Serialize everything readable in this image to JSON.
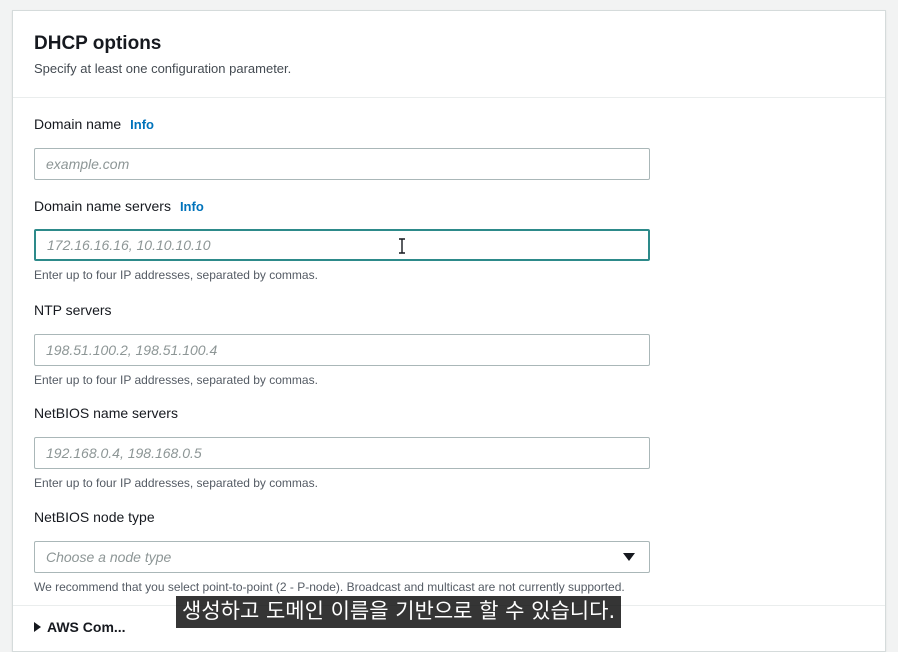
{
  "section": {
    "title": "DHCP options",
    "description": "Specify at least one configuration parameter."
  },
  "fields": {
    "domain_name": {
      "label": "Domain name",
      "info": "Info",
      "placeholder": "example.com",
      "value": ""
    },
    "domain_name_servers": {
      "label": "Domain name servers",
      "info": "Info",
      "placeholder": "172.16.16.16, 10.10.10.10",
      "value": "",
      "hint": "Enter up to four IP addresses, separated by commas."
    },
    "ntp_servers": {
      "label": "NTP servers",
      "placeholder": "198.51.100.2, 198.51.100.4",
      "value": "",
      "hint": "Enter up to four IP addresses, separated by commas."
    },
    "netbios_name_servers": {
      "label": "NetBIOS name servers",
      "placeholder": "192.168.0.4, 198.168.0.5",
      "value": "",
      "hint": "Enter up to four IP addresses, separated by commas."
    },
    "netbios_node_type": {
      "label": "NetBIOS node type",
      "placeholder": "Choose a node type",
      "hint": "We recommend that you select point-to-point (2 - P-node). Broadcast and multicast are not currently supported."
    }
  },
  "next_section": {
    "label": "AWS Com..."
  },
  "subtitle": "생성하고 도메인 이름을 기반으로 할 수 있습니다.",
  "colors": {
    "accent_link": "#0073bb",
    "focus_border": "#2d8a8a",
    "input_border": "#aab7b8",
    "page_background": "#f2f3f3"
  },
  "icons": {
    "select_caret": "caret-down-icon",
    "text_cursor": "i-beam-cursor-icon",
    "expand": "caret-right-icon"
  }
}
